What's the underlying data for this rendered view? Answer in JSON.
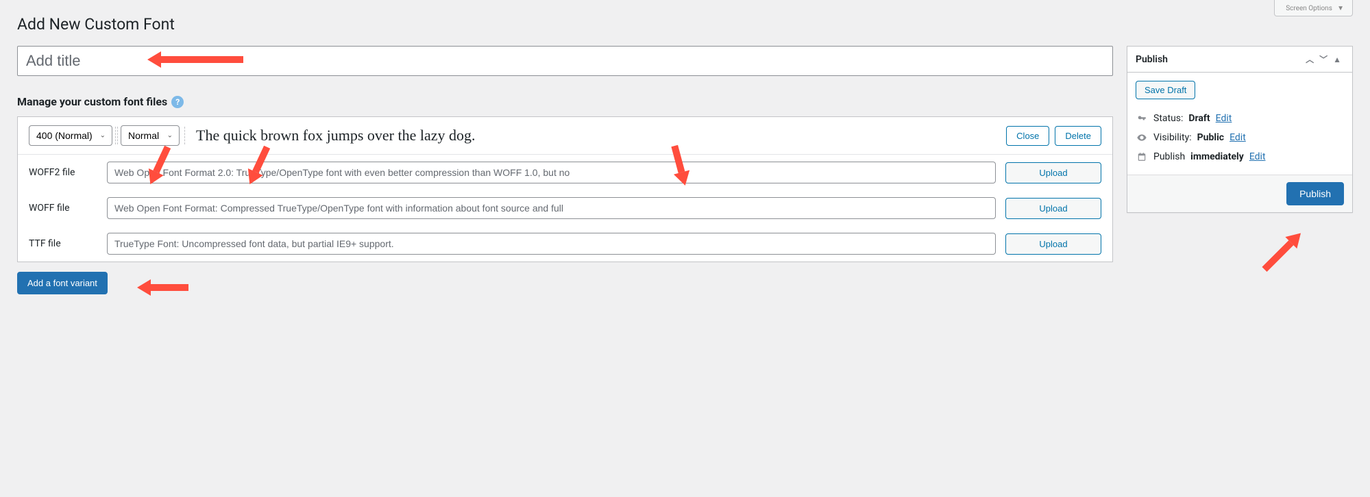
{
  "screenOptions": {
    "label": "Screen Options"
  },
  "page": {
    "title": "Add New Custom Font"
  },
  "titleField": {
    "placeholder": "Add title",
    "value": ""
  },
  "manage": {
    "heading": "Manage your custom font files"
  },
  "variant": {
    "weight": "400 (Normal)",
    "style": "Normal",
    "previewText": "The quick brown fox jumps over the lazy dog.",
    "closeLabel": "Close",
    "deleteLabel": "Delete"
  },
  "files": {
    "woff2": {
      "label": "WOFF2 file",
      "placeholder": "Web Open Font Format 2.0: TrueType/OpenType font with even better compression than WOFF 1.0, but no"
    },
    "woff": {
      "label": "WOFF file",
      "placeholder": "Web Open Font Format: Compressed TrueType/OpenType font with information about font source and full"
    },
    "ttf": {
      "label": "TTF file",
      "placeholder": "TrueType Font: Uncompressed font data, but partial IE9+ support."
    },
    "uploadLabel": "Upload"
  },
  "addVariant": {
    "label": "Add a font variant"
  },
  "publishBox": {
    "title": "Publish",
    "saveDraft": "Save Draft",
    "statusLabel": "Status:",
    "statusValue": "Draft",
    "visibilityLabel": "Visibility:",
    "visibilityValue": "Public",
    "scheduleLabel": "Publish",
    "scheduleValue": "immediately",
    "editLabel": "Edit",
    "publishButton": "Publish"
  }
}
